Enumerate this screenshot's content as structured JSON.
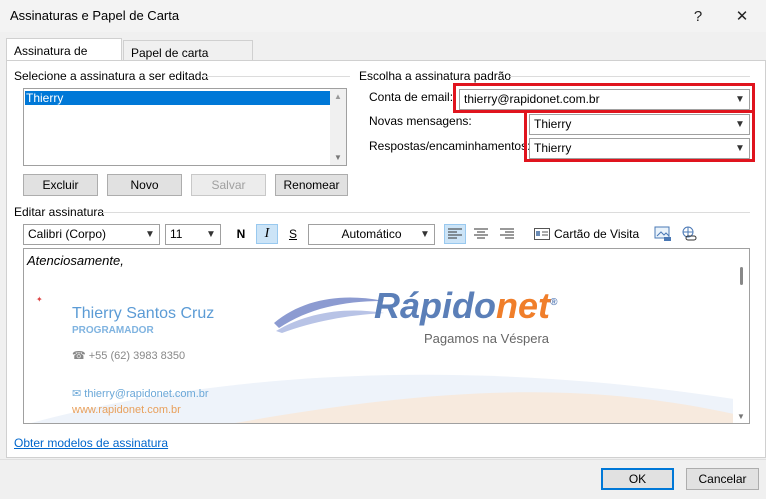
{
  "window": {
    "title": "Assinaturas e Papel de Carta",
    "help": "?",
    "close": "✕"
  },
  "tabs": [
    {
      "label": "Assinatura de Email"
    },
    {
      "label": "Papel de carta pessoal"
    }
  ],
  "select_section": {
    "label": "Selecione a assinatura a ser editada",
    "items": [
      "Thierry"
    ],
    "buttons": {
      "delete": "Excluir",
      "new": "Novo",
      "save": "Salvar",
      "rename": "Renomear"
    }
  },
  "default_section": {
    "label": "Escolha a assinatura padrão",
    "account_label": "Conta de email:",
    "account_value": "thierry@rapidonet.com.br",
    "new_messages_label": "Novas mensagens:",
    "new_messages_value": "Thierry",
    "replies_label": "Respostas/encaminhamentos:",
    "replies_value": "Thierry"
  },
  "edit_section": {
    "label": "Editar assinatura",
    "font": "Calibri (Corpo)",
    "size": "11",
    "bold": "N",
    "italic": "I",
    "underline": "S",
    "color": "Automático",
    "business_card": "Cartão de Visita"
  },
  "signature": {
    "greeting": "Atenciosamente,",
    "name": "Thierry Santos Cruz",
    "role": "PROGRAMADOR",
    "phone": "☎ +55 (62) 3983 8350",
    "email": "✉ thierry@rapidonet.com.br",
    "website": "www.rapidonet.com.br",
    "logo_main": "Rápido",
    "logo_accent": "net",
    "logo_reg": "®",
    "logo_tagline": "Pagamos na Véspera"
  },
  "footer": {
    "link": "Obter modelos de assinatura",
    "ok": "OK",
    "cancel": "Cancelar"
  },
  "colors": {
    "accent": "#0078d7",
    "highlight": "#e0141e"
  }
}
